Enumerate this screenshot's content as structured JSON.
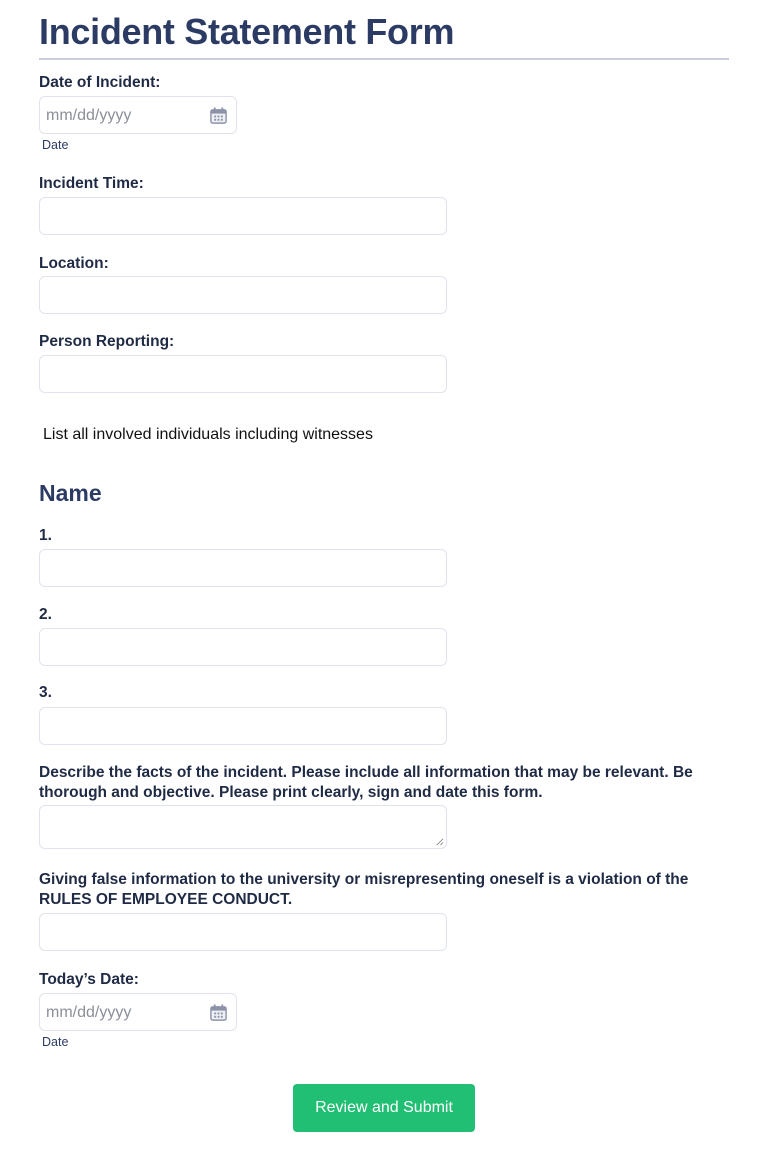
{
  "form": {
    "title": "Incident Statement Form",
    "fields": {
      "date_of_incident": {
        "label": "Date of Incident:",
        "placeholder": "mm/dd/yyyy",
        "sublabel": "Date",
        "value": ""
      },
      "incident_time": {
        "label": "Incident Time:",
        "value": ""
      },
      "location": {
        "label": "Location:",
        "value": ""
      },
      "person_reporting": {
        "label": "Person Reporting:",
        "value": ""
      }
    },
    "instruction": "List all involved individuals including witnesses",
    "names_section": {
      "heading": "Name",
      "items": [
        {
          "label": "1.",
          "value": ""
        },
        {
          "label": "2.",
          "value": ""
        },
        {
          "label": "3.",
          "value": ""
        }
      ]
    },
    "facts": {
      "label": "Describe the facts of the incident. Please include all information that may be relevant. Be thorough and objective. Please print clearly, sign and date this form.",
      "value": ""
    },
    "false_info": {
      "label": "Giving false information to the university or misrepresenting oneself is a violation of the RULES OF EMPLOYEE CONDUCT.",
      "value": ""
    },
    "todays_date": {
      "label": "Today’s Date:",
      "placeholder": "mm/dd/yyyy",
      "sublabel": "Date",
      "value": ""
    },
    "submit_label": "Review and Submit"
  },
  "colors": {
    "heading": "#2c3b63",
    "label": "#1f2a44",
    "input_border": "#dfe3ee",
    "submit_button": "#21bf73",
    "divider": "#c9ced8"
  },
  "icons": {
    "date_picker": "calendar-icon"
  }
}
